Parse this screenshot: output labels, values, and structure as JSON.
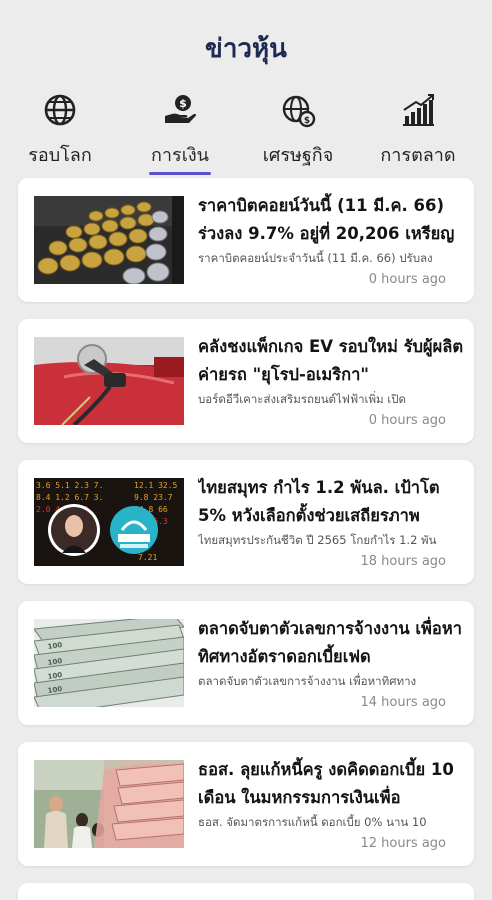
{
  "header": {
    "title": "ข่าวหุ้น"
  },
  "tabs": [
    {
      "label": "รอบโลก",
      "icon": "globe-icon",
      "active": false
    },
    {
      "label": "การเงิน",
      "icon": "money-hand-icon",
      "active": true
    },
    {
      "label": "เศรษฐกิจ",
      "icon": "globe-gear-icon",
      "active": false
    },
    {
      "label": "การตลาด",
      "icon": "bar-chart-up-icon",
      "active": false
    }
  ],
  "accent_color": "#5a4fcf",
  "news": [
    {
      "title": "ราคาบิตคอยน์วันนี้ (11 มี.ค. 66) ร่วงลง 9.7% อยู่ที่ 20,206 เหรียญ",
      "summary": "ราคาบิตคอยน์ประจำวันนี้ (11 มี.ค. 66) ปรับลง",
      "time": "0 hours ago",
      "image": "bitcoin-coins-image"
    },
    {
      "title": "คลังชงแพ็กเกจ EV รอบใหม่ รับผู้ผลิตค่ายรถ \"ยุโรป-อเมริกา\"",
      "summary": "บอร์ดอีวีเคาะส่งเสริมรถยนต์ไฟฟ้าเพิ่ม เปิด",
      "time": "0 hours ago",
      "image": "ev-charging-image"
    },
    {
      "title": "ไทยสมุทร กำไร 1.2 พันล. เป้าโต 5% หวังเลือกตั้งช่วยเสถียรภาพ",
      "summary": "ไทยสมุทรประกันชีวิต ปี 2565 โกยกำไร 1.2 พัน",
      "time": "18 hours ago",
      "image": "insurance-executive-image"
    },
    {
      "title": "ตลาดจับตาตัวเลขการจ้างงาน เพื่อหาทิศทางอัตราดอกเบี้ยเฟด",
      "summary": "ตลาดจับตาตัวเลขการจ้างงาน เพื่อหาทิศทาง",
      "time": "14 hours ago",
      "image": "dollar-bills-image"
    },
    {
      "title": "ธอส. ลุยแก้หนี้ครู งดคิดดอกเบี้ย 10 เดือน ในมหกรรมการเงินเพื่อ",
      "summary": "ธอส. จัดมาตรการแก้หนี้ ดอกเบี้ย 0% นาน 10",
      "time": "12 hours ago",
      "image": "teacher-money-image"
    }
  ]
}
